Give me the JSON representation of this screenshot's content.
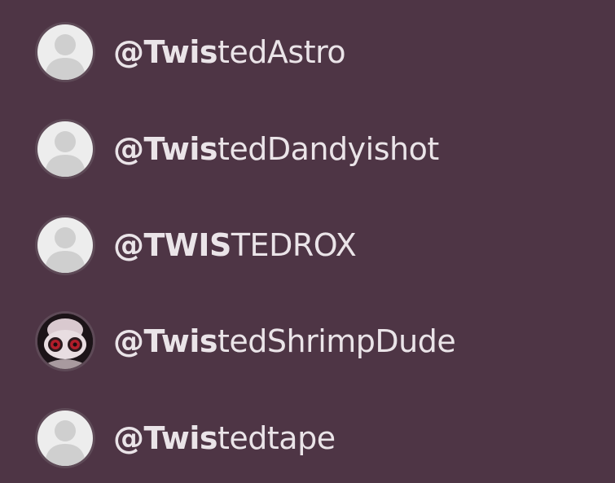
{
  "mention_suggestions": [
    {
      "prefix": "@",
      "match": "Twis",
      "rest": "tedAstro",
      "avatar": "default-user-icon"
    },
    {
      "prefix": "@",
      "match": "Twis",
      "rest": "tedDandyishot",
      "avatar": "default-user-icon"
    },
    {
      "prefix": "@",
      "match": "TWIS",
      "rest": "TEDROX",
      "avatar": "default-user-icon"
    },
    {
      "prefix": "@",
      "match": "Twis",
      "rest": "tedShrimpDude",
      "avatar": "custom-photo"
    },
    {
      "prefix": "@",
      "match": "Twis",
      "rest": "tedtape",
      "avatar": "default-user-icon"
    }
  ],
  "colors": {
    "background": "#4e3545",
    "text": "#eae4e8",
    "default_avatar_bg": "#ededed",
    "default_avatar_figure": "#cfcfcf"
  }
}
